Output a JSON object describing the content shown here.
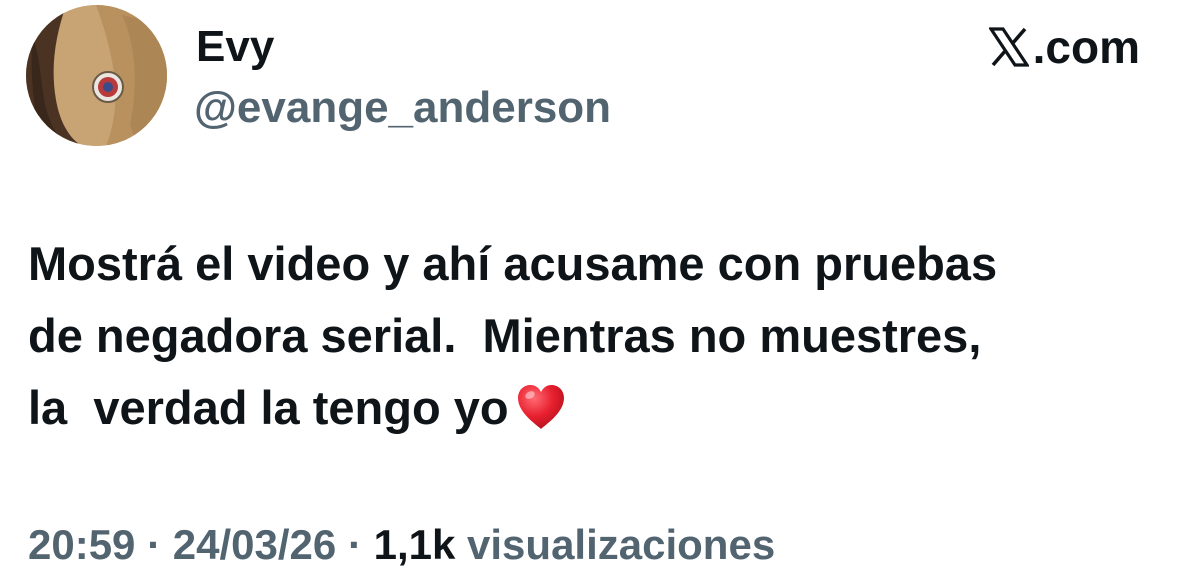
{
  "author": {
    "display_name": "Evy",
    "handle": "@evange_anderson"
  },
  "source": {
    "icon": "x-logo-icon",
    "label": ".com"
  },
  "tweet": {
    "lines": [
      "Mostrá el video y ahí acusame con pruebas",
      "de negadora serial.  Mientras no muestres,",
      "la  verdad la tengo yo"
    ],
    "emoji": "heart-icon"
  },
  "meta": {
    "time": "20:59",
    "separator": "·",
    "date": "24/03/26",
    "views_count": "1,1k",
    "views_label": "visualizaciones"
  },
  "colors": {
    "text_primary": "#0f1419",
    "text_secondary": "#536471",
    "heart": "#e8202f"
  }
}
